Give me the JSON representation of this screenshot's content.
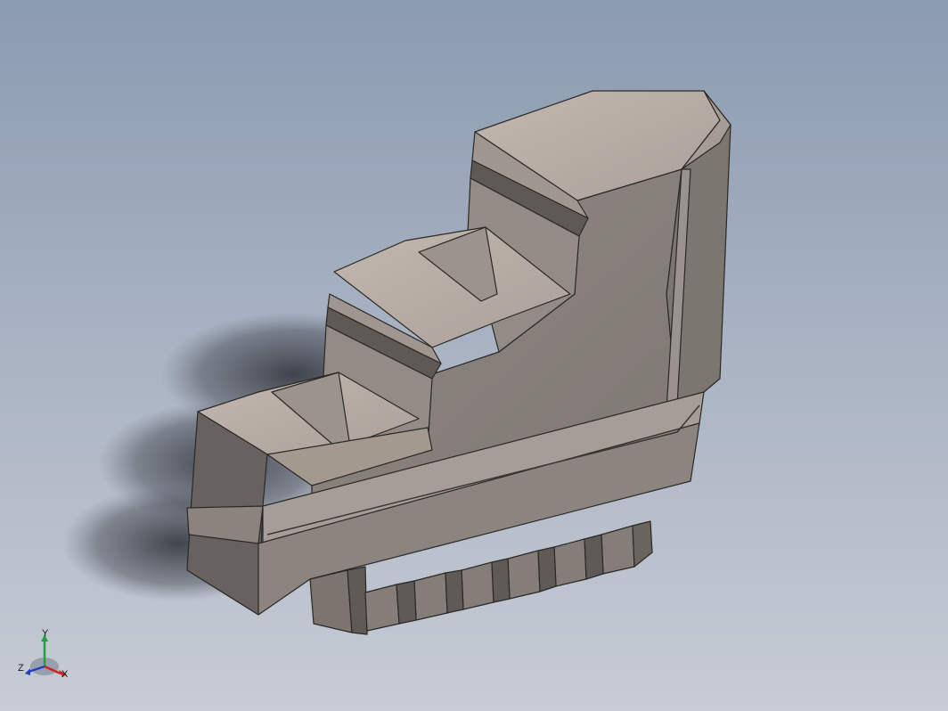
{
  "viewport": {
    "background_top": "#8b9bb0",
    "background_bottom": "#c7ccd5"
  },
  "model": {
    "name": "chuck-jaw",
    "colors": {
      "lit_face": "#b9aea7",
      "mid_face": "#8e8680",
      "dark_face": "#6f6964",
      "edge": "#2a2826",
      "shadow": "#3a3d44"
    }
  },
  "triad": {
    "x_label": "X",
    "y_label": "Y",
    "z_label": "Z",
    "x_color": "#d22020",
    "y_color": "#20a040",
    "z_color": "#2040c0"
  }
}
